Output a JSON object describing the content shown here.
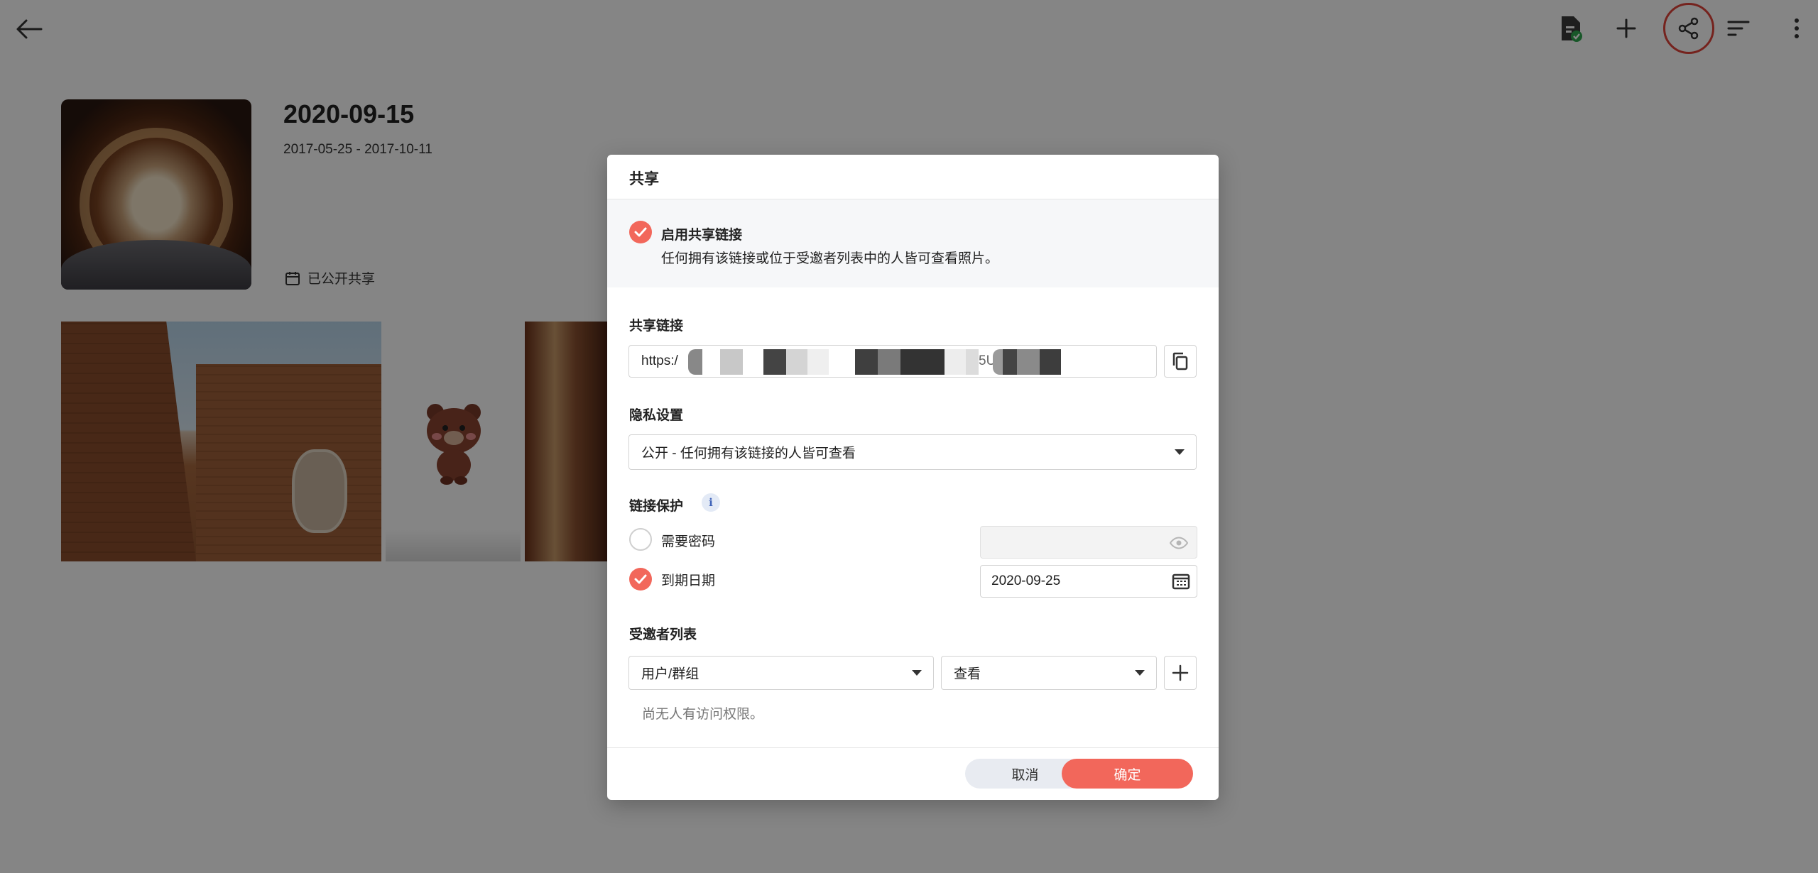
{
  "topbar": {
    "back_icon": "arrow-left-icon",
    "icons": [
      "file-check-icon",
      "plus-icon",
      "share-icon",
      "sort-icon",
      "more-vertical-icon"
    ],
    "highlight_color": "#e0433a"
  },
  "album": {
    "title": "2020-09-15",
    "date_range": "2017-05-25 - 2017-10-11",
    "share_status": "已公开共享"
  },
  "dialog": {
    "title": "共享",
    "enable": {
      "label": "启用共享链接",
      "description": "任何拥有该链接或位于受邀者列表中的人皆可查看照片。",
      "checked": true
    },
    "share_link": {
      "section_label": "共享链接",
      "value_prefix": "https:/",
      "value_fragment": "5U",
      "copy_icon": "copy-icon"
    },
    "privacy": {
      "section_label": "隐私设置",
      "selected": "公开 - 任何拥有该链接的人皆可查看"
    },
    "link_protection": {
      "section_label": "链接保护",
      "info_icon": "i",
      "require_password": {
        "label": "需要密码",
        "checked": false,
        "value": ""
      },
      "expiry": {
        "label": "到期日期",
        "checked": true,
        "value": "2020-09-25"
      }
    },
    "invitees": {
      "section_label": "受邀者列表",
      "user_placeholder": "用户/群组",
      "permission": "查看",
      "empty_text": "尚无人有访问权限。"
    },
    "buttons": {
      "cancel": "取消",
      "confirm": "确定"
    },
    "accent_color": "#f2675b"
  }
}
